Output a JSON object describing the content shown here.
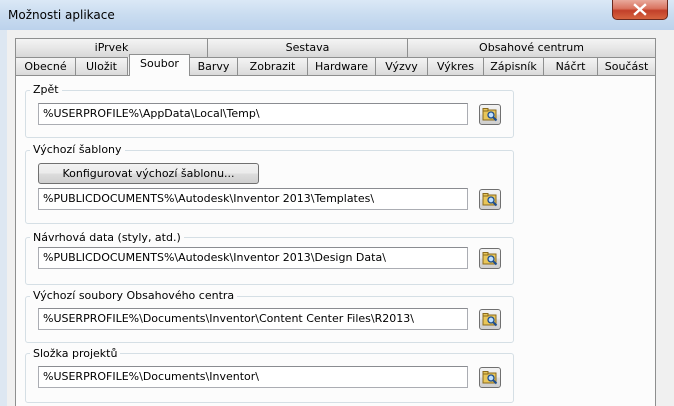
{
  "window": {
    "title": "Možnosti aplikace"
  },
  "tabs_row1": [
    {
      "label": "iPrvek"
    },
    {
      "label": "Sestava"
    },
    {
      "label": "Obsahové centrum"
    }
  ],
  "tabs_row2": [
    {
      "label": "Obecné"
    },
    {
      "label": "Uložit"
    },
    {
      "label": "Soubor",
      "active": true
    },
    {
      "label": "Barvy"
    },
    {
      "label": "Zobrazit"
    },
    {
      "label": "Hardware"
    },
    {
      "label": "Výzvy"
    },
    {
      "label": "Výkres"
    },
    {
      "label": "Zápisník"
    },
    {
      "label": "Náčrt"
    },
    {
      "label": "Součást"
    }
  ],
  "groups": {
    "undo": {
      "label": "Zpět",
      "path": "%USERPROFILE%\\AppData\\Local\\Temp\\"
    },
    "templates": {
      "label": "Výchozí šablony",
      "button": "Konfigurovat výchozí šablonu...",
      "path": "%PUBLICDOCUMENTS%\\Autodesk\\Inventor 2013\\Templates\\"
    },
    "design_data": {
      "label": "Návrhová data (styly, atd.)",
      "path": "%PUBLICDOCUMENTS%\\Autodesk\\Inventor 2013\\Design Data\\"
    },
    "content_center": {
      "label": "Výchozí soubory Obsahového centra",
      "path": "%USERPROFILE%\\Documents\\Inventor\\Content Center Files\\R2013\\"
    },
    "projects": {
      "label": "Složka projektů",
      "path": "%USERPROFILE%\\Documents\\Inventor\\"
    }
  },
  "icons": {
    "close": "close-icon",
    "browse": "folder-browse-icon"
  }
}
